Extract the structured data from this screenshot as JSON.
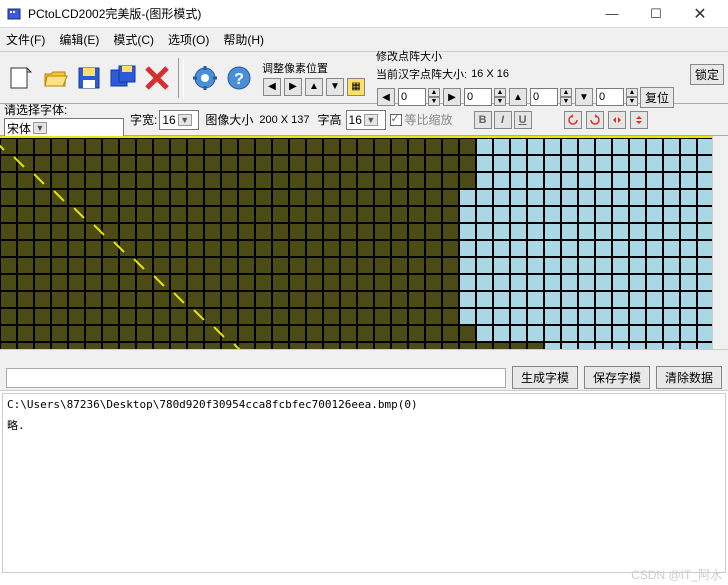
{
  "window": {
    "title": "PCtoLCD2002完美版-(图形模式)",
    "min": "—",
    "max": "☐",
    "close": "✕"
  },
  "menu": {
    "file": "文件(F)",
    "edit": "编辑(E)",
    "mode": "模式(C)",
    "options": "选项(O)",
    "help": "帮助(H)"
  },
  "toolbar": {
    "adjust_pixel_pos": "调整像素位置",
    "modify_matrix_size": "修改点阵大小",
    "current_hz_size_label": "当前汉字点阵大小:",
    "current_size": "16 X 16",
    "lock": "锁定",
    "reset": "复位"
  },
  "row2": {
    "select_font_label": "请选择字体:",
    "font_value": "宋体",
    "image_size_label": "图像大小",
    "image_size_value": "200 X 137",
    "char_width_label": "字宽:",
    "char_width_value": "16",
    "char_height_label": "字高",
    "char_height_value": "16",
    "scale_checkbox": "等比缩放",
    "B": "B",
    "I": "I",
    "U": "U",
    "spin0": "0",
    "spin1": "0",
    "spin2": "0",
    "spin3": "0"
  },
  "buttons": {
    "gen": "生成字模",
    "save": "保存字模",
    "clear": "清除数据"
  },
  "output": {
    "line1": "C:\\Users\\87236\\Desktop\\780d920f30954cca8fcbfec700126eea.bmp(0)",
    "line2": "略."
  },
  "watermark": "CSDN @IT_阿水",
  "canvas": {
    "cols": 43,
    "rows": 13,
    "dark_widths": [
      28,
      28,
      28,
      27,
      27,
      27,
      27,
      27,
      27,
      27,
      27,
      28,
      32
    ]
  }
}
